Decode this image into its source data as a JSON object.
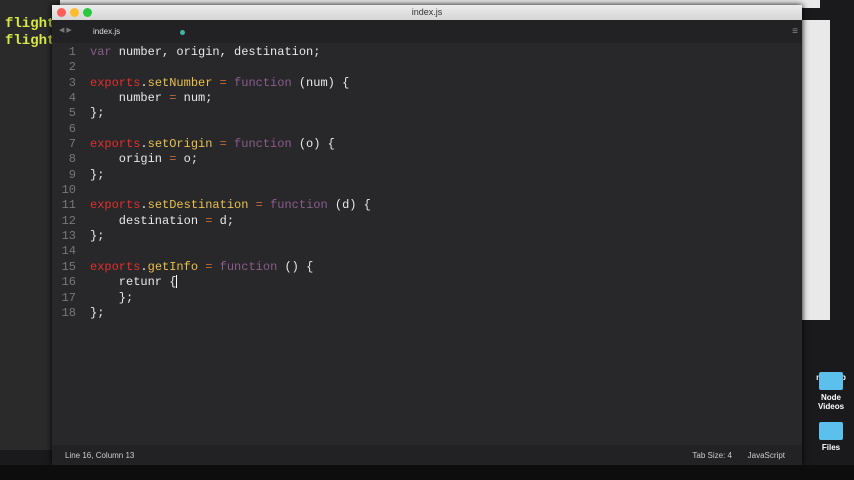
{
  "terminal": {
    "lines": [
      "flight",
      "flight"
    ]
  },
  "desktop": {
    "items": [
      "newapp",
      "Node Videos",
      "Files"
    ]
  },
  "window": {
    "title": "index.js",
    "tab": "index.js"
  },
  "code": [
    [
      [
        "t-kw",
        "var"
      ],
      [
        "t-txt",
        " number, origin, destination;"
      ]
    ],
    [],
    [
      [
        "t-ex",
        "exports"
      ],
      [
        "t-txt",
        "."
      ],
      [
        "t-fn",
        "setNumber"
      ],
      [
        "t-op",
        " = "
      ],
      [
        "t-kw",
        "function"
      ],
      [
        "t-txt",
        " (num) {"
      ]
    ],
    [
      [
        "t-txt",
        "    number "
      ],
      [
        "t-op",
        "="
      ],
      [
        "t-txt",
        " num;"
      ]
    ],
    [
      [
        "t-txt",
        "};"
      ]
    ],
    [],
    [
      [
        "t-ex",
        "exports"
      ],
      [
        "t-txt",
        "."
      ],
      [
        "t-fn",
        "setOrigin"
      ],
      [
        "t-op",
        " = "
      ],
      [
        "t-kw",
        "function"
      ],
      [
        "t-txt",
        " (o) {"
      ]
    ],
    [
      [
        "t-txt",
        "    origin "
      ],
      [
        "t-op",
        "="
      ],
      [
        "t-txt",
        " o;"
      ]
    ],
    [
      [
        "t-txt",
        "};"
      ]
    ],
    [],
    [
      [
        "t-ex",
        "exports"
      ],
      [
        "t-txt",
        "."
      ],
      [
        "t-fn",
        "setDestination"
      ],
      [
        "t-op",
        " = "
      ],
      [
        "t-kw",
        "function"
      ],
      [
        "t-txt",
        " (d) {"
      ]
    ],
    [
      [
        "t-txt",
        "    destination "
      ],
      [
        "t-op",
        "="
      ],
      [
        "t-txt",
        " d;"
      ]
    ],
    [
      [
        "t-txt",
        "};"
      ]
    ],
    [],
    [
      [
        "t-ex",
        "exports"
      ],
      [
        "t-txt",
        "."
      ],
      [
        "t-fn",
        "getInfo"
      ],
      [
        "t-op",
        " = "
      ],
      [
        "t-kw",
        "function"
      ],
      [
        "t-txt",
        " () {"
      ]
    ],
    [
      [
        "t-txt",
        "    retunr {"
      ]
    ],
    [
      [
        "t-txt",
        "    };"
      ]
    ],
    [
      [
        "t-txt",
        "};"
      ]
    ]
  ],
  "cursor_line": 16,
  "status": {
    "position": "Line 16, Column 13",
    "tab_size": "Tab Size: 4",
    "syntax": "JavaScript"
  }
}
